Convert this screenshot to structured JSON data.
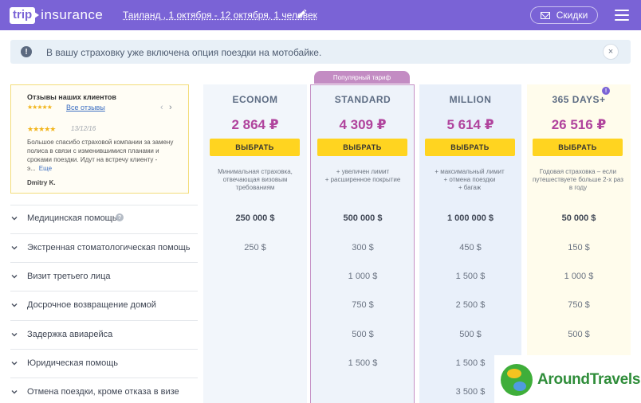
{
  "header": {
    "logo_box": "trip",
    "logo_text": "insurance",
    "trip_summary": "Таиланд , 1 октября - 12 октября, 1 человек",
    "discount_label": "Скидки",
    "bg_color": "#7a63d6"
  },
  "notice": {
    "icon": "!",
    "text": "В вашу страховку уже включена опция поездки на мотобайке.",
    "close": "×"
  },
  "reviews": {
    "title": "Отзывы наших клиентов",
    "summary_stars": "★★★★★",
    "all_link": "Все отзывы",
    "prev": "‹",
    "next": "›",
    "item": {
      "stars": "★★★★★",
      "date": "13/12/16",
      "text": "Большое спасибо страховой компании за замену полиса в связи с изменившимися планами и сроками поездки. Идут на встречу клиенту - э...",
      "more": "Еще",
      "author": "Dmitry K."
    }
  },
  "popular_badge": "Популярный тариф",
  "plans": [
    {
      "name": "ECONOM",
      "price": "2 864 ₽",
      "button": "ВЫБРАТЬ",
      "desc": "Минимальная страховка, отвечающая визовым требованиям"
    },
    {
      "name": "STANDARD",
      "price": "4 309 ₽",
      "button": "ВЫБРАТЬ",
      "desc": "+ увеличен лимит\n+ расширенное покрытие"
    },
    {
      "name": "MILLION",
      "price": "5 614 ₽",
      "button": "ВЫБРАТЬ",
      "desc": "+ максимальный лимит\n+ отмена поездки\n+ багаж"
    },
    {
      "name": "365 DAYS+",
      "price": "26 516 ₽",
      "button": "ВЫБРАТЬ",
      "desc": "Годовая страховка – если путешествуете больше 2-х раз в году"
    }
  ],
  "plan_badge": "!",
  "rows": [
    {
      "label": "Медицинская помощь",
      "values": [
        "250 000 $",
        "500 000 $",
        "1 000 000 $",
        "50 000 $"
      ]
    },
    {
      "label": "Экстренная стоматологическая помощь",
      "values": [
        "250 $",
        "300 $",
        "450 $",
        "150 $"
      ]
    },
    {
      "label": "Визит третьего лица",
      "values": [
        "",
        "1 000 $",
        "1 500 $",
        "1 000 $"
      ]
    },
    {
      "label": "Досрочное возвращение домой",
      "values": [
        "",
        "750 $",
        "2 500 $",
        "750 $"
      ]
    },
    {
      "label": "Задержка авиарейса",
      "values": [
        "",
        "500 $",
        "500 $",
        "500 $"
      ]
    },
    {
      "label": "Юридическая помощь",
      "values": [
        "",
        "1 500 $",
        "1 500 $",
        ""
      ]
    },
    {
      "label": "Отмена поездки, кроме отказа в визе",
      "values": [
        "",
        "",
        "3 500 $",
        ""
      ]
    }
  ],
  "help_icon": "?",
  "watermark": "AroundTravels"
}
